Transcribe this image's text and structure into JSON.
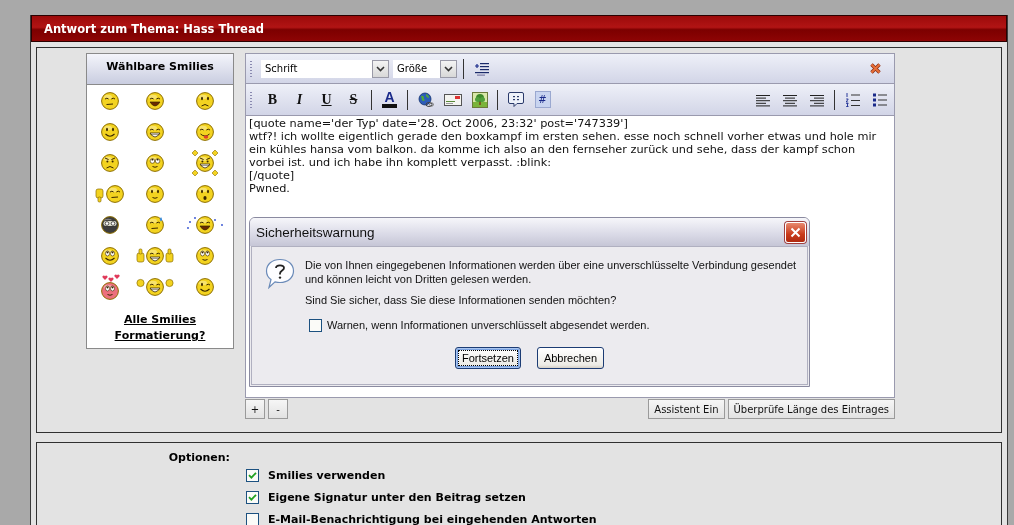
{
  "header": {
    "title": "Antwort zum Thema: Hass Thread"
  },
  "smilies_panel": {
    "title": "Wählbare Smilies",
    "links": [
      "Alle Smilies",
      "Formatierung?"
    ]
  },
  "editor": {
    "font_select": {
      "value": "Schrift"
    },
    "size_select": {
      "value": "Größe"
    },
    "toolbar_left": [
      [
        {
          "kind": "bold",
          "label": "B"
        },
        {
          "kind": "italic",
          "label": "I"
        },
        {
          "kind": "underline",
          "label": "U"
        },
        {
          "kind": "strike",
          "label": "S"
        }
      ],
      [
        {
          "kind": "color",
          "label": "A"
        }
      ],
      [
        {
          "kind": "link"
        },
        {
          "kind": "email"
        },
        {
          "kind": "image"
        }
      ],
      [
        {
          "kind": "quote"
        },
        {
          "kind": "code",
          "label": "#"
        }
      ]
    ],
    "toolbar_right": [
      [
        {
          "kind": "align-left"
        },
        {
          "kind": "align-center"
        },
        {
          "kind": "align-right"
        }
      ],
      [
        {
          "kind": "ordered-list"
        },
        {
          "kind": "bullet-list"
        }
      ]
    ],
    "message": {
      "value": "[quote name='der Typ' date='28. Oct 2006, 23:32' post='747339']\nwtf?! ich wollte eigentlich gerade den boxkampf im ersten sehen. esse noch schnell vorher etwas und hole mir\nein kühles hansa vom balkon. da komme ich also an den fernseher zurück und sehe, dass der kampf schon\nvorbei ist. und ich habe ihn komplett verpasst. :blink:\n[/quote]\nPwned."
    },
    "left_buttons": [
      "+",
      "-"
    ],
    "right_buttons": [
      "Assistent Ein",
      "Überprüfe Länge des Eintrages"
    ]
  },
  "dialog": {
    "title": "Sicherheitswarnung",
    "message": "Die von Ihnen eingegebenen Informationen werden über eine unverschlüsselte Verbindung gesendet und können leicht von Dritten gelesen werden.",
    "question": "Sind Sie sicher, dass Sie diese Informationen senden möchten?",
    "checkbox": {
      "label": "Warnen, wenn Informationen unverschlüsselt abgesendet werden.",
      "checked": false
    },
    "buttons": [
      {
        "label": "Fortsetzen",
        "focused": true
      },
      {
        "label": "Abbrechen",
        "focused": false
      }
    ]
  },
  "options": {
    "label": "Optionen:",
    "items": [
      {
        "label": "Smilies verwenden",
        "checked": true
      },
      {
        "label": "Eigene Signatur unter den Beitrag setzen",
        "checked": true
      },
      {
        "label": "E-Mail-Benachrichtigung bei eingehenden Antworten",
        "checked": false
      }
    ]
  }
}
